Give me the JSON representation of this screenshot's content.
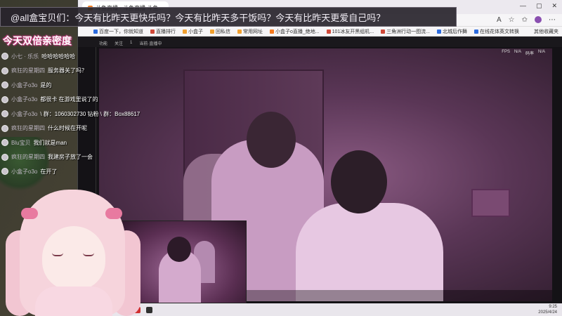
{
  "banner": {
    "text": "@all盒宝贝们：今天有比昨天更快乐吗？今天有比昨天多干饭吗？今天有比昨天更爱自己吗？"
  },
  "overlay": {
    "title": "今天双倍亲密度"
  },
  "browser": {
    "tab_title": "斗鱼直播 - 斗鱼直播 斗鱼...",
    "window_controls": [
      "—",
      "▢",
      "✕"
    ],
    "bookmarks": [
      "百度一下，你就知道",
      "直播排行",
      "小盒子",
      "回私信",
      "常用网址",
      "小盒子o直播_绝地...",
      "101冰友开黑组机...",
      "三角洲行动一图流...",
      "北城后作舞",
      "在线花体英文转换"
    ],
    "bookmarks_right": "其他收藏夹"
  },
  "player": {
    "topbar": [
      "功能",
      "关注",
      "1",
      "当前·直播中"
    ],
    "hud": [
      "FPS",
      "N/A",
      "码率",
      "N/A"
    ]
  },
  "chat": [
    {
      "name": "小七 · 乐乐",
      "message": "哈哈哈哈哈哈"
    },
    {
      "name": "疯狂的星期四",
      "message": "服务器关了吗？"
    },
    {
      "name": "小盒子o3o",
      "message": "是的"
    },
    {
      "name": "小盒子o3o",
      "message": "都很卡 在游戏里说了的"
    },
    {
      "name": "小盒子o3o",
      "message": "\\ 群：1060302730 钻粉 \\ 群：Box88617"
    },
    {
      "name": "疯狂的星期四",
      "message": "什么时候在开呢"
    },
    {
      "name": "Blu宝贝",
      "message": "我们就是man"
    },
    {
      "name": "疯狂的星期四",
      "message": "我建房子放了一会"
    },
    {
      "name": "小盒子o3o",
      "message": "在开了"
    }
  ],
  "taskbar": {
    "time": "9:25",
    "date": "2025/4/24"
  },
  "colors": {
    "banner_bg": "#28242c",
    "title_glow": "#d04a88",
    "video_tint": "#8a5a82"
  }
}
